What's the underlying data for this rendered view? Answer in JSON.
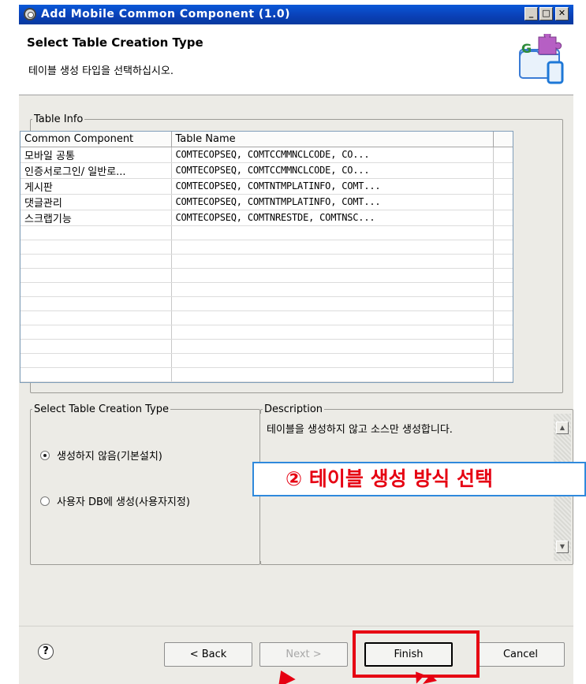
{
  "window": {
    "title": "Add Mobile Common Component (1.0)"
  },
  "header": {
    "title": "Select Table Creation Type",
    "subtitle": "테이블 생성 타입을 선택하십시오."
  },
  "table_info": {
    "legend": "Table Info",
    "columns": [
      "Common Component",
      "Table Name"
    ],
    "rows": [
      {
        "component": "모바일 공통",
        "table_name": "COMTECOPSEQ, COMTCCMMNCLCODE, CO..."
      },
      {
        "component": "인증서로그인/ 일반로...",
        "table_name": "COMTECOPSEQ, COMTCCMMNCLCODE, CO..."
      },
      {
        "component": "게시판",
        "table_name": "COMTECOPSEQ, COMTNTMPLATINFO, COMT..."
      },
      {
        "component": "댓글관리",
        "table_name": "COMTECOPSEQ, COMTNTMPLATINFO, COMT..."
      },
      {
        "component": "스크랩기능",
        "table_name": "COMTECOPSEQ, COMTNRESTDE, COMTNSC..."
      }
    ]
  },
  "creation_type": {
    "legend": "Select Table Creation Type",
    "options": [
      {
        "label": "생성하지 않음(기본설치)",
        "selected": true
      },
      {
        "label": "사용자 DB에 생성(사용자지정)",
        "selected": false
      }
    ]
  },
  "description": {
    "legend": "Description",
    "text": "테이블을 생성하지 않고 소스만 생성합니다."
  },
  "annotation": {
    "text": "② 테이블 생성 방식 선택"
  },
  "buttons": {
    "help": "?",
    "back": "< Back",
    "next": "Next >",
    "finish": "Finish",
    "cancel": "Cancel"
  },
  "colors": {
    "title_bar": "#0a4fc8",
    "highlight": "#e60012",
    "callout_border": "#2f89dc"
  }
}
